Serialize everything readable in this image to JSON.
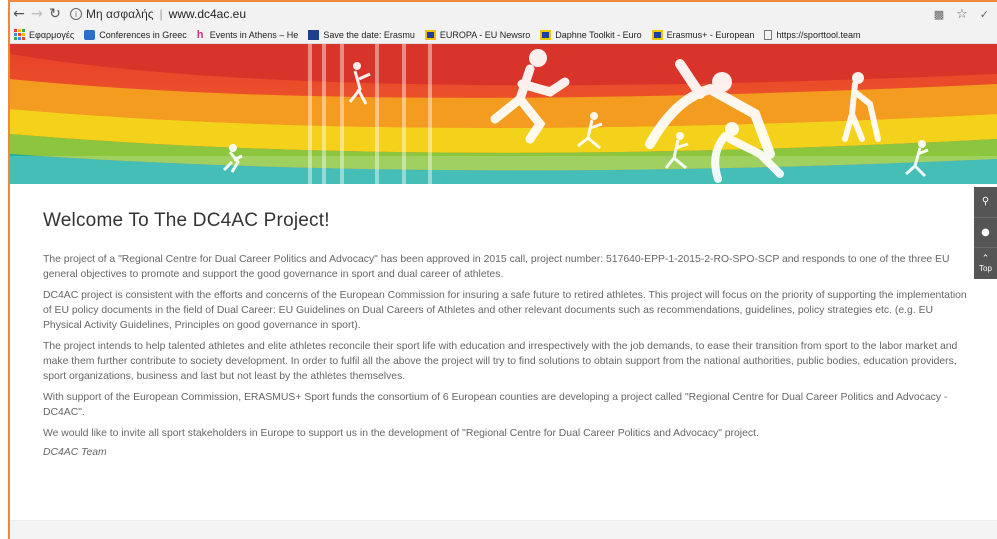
{
  "browser": {
    "url_security_label": "Μη ασφαλής",
    "url_separator": "|",
    "url_host": "www.dc4ac.eu"
  },
  "bookmarks": [
    {
      "label": "Εφαρμογές",
      "icon": "apps-grid-icon"
    },
    {
      "label": "Conferences in Greec",
      "icon": "blue-bookmark-icon"
    },
    {
      "label": "Events in Athens – He",
      "icon": "h-logo-icon"
    },
    {
      "label": "Save the date: Erasmu",
      "icon": "blue-square-icon"
    },
    {
      "label": "EUROPA - EU Newsro",
      "icon": "eu-flag-icon"
    },
    {
      "label": "Daphne Toolkit - Euro",
      "icon": "eu-flag-icon"
    },
    {
      "label": "Erasmus+ - European",
      "icon": "eu-flag-icon"
    },
    {
      "label": "https://sporttool.team",
      "icon": "page-icon"
    }
  ],
  "page": {
    "title": "Welcome To The DC4AC Project!",
    "paragraphs": [
      "The project of a \"Regional Centre for Dual Career Politics and Advocacy\" has been approved in 2015 call, project number: 517640-EPP-1-2015-2-RO-SPO-SCP and responds to one of the three EU general objectives to promote and support the good governance in sport and dual career of athletes.",
      "DC4AC project is consistent with the efforts and concerns of the European Commission for insuring a safe future to retired athletes. This project will focus on the priority of supporting the implementation of EU policy documents in the field of Dual Career: EU Guidelines on Dual Careers of Athletes and other relevant documents such as recommendations, guidelines, policy strategies etc. (e.g. EU Physical Activity Guidelines, Principles on good governance in sport).",
      "The project intends to help talented athletes and elite athletes reconcile their sport life with education and irrespectively with the job demands, to ease their transition from sport to the labor market and make them further contribute to society development. In order to fulfil all the above the project will try to find solutions to obtain support from the national authorities, public bodies, education providers, sport organizations, business and last but not least by the athletes themselves.",
      "With support of the European Commission, ERASMUS+ Sport funds the consortium of 6 European counties are developing a project called \"Regional Centre for Dual Career Politics and Advocacy - DC4AC\".",
      "We would like to invite all sport stakeholders in Europe to support us in the development of \"Regional Centre for Dual Career Politics and Advocacy\" project."
    ],
    "signature": "DC4AC Team"
  },
  "side_widget": {
    "top_label": "Top"
  },
  "colors": {
    "frame": "#f0883a",
    "banner_red": "#e8432a",
    "banner_orange": "#f39c1f",
    "banner_yellow": "#f4d21c",
    "banner_green": "#8cc63e",
    "banner_teal": "#1bb0a8"
  }
}
